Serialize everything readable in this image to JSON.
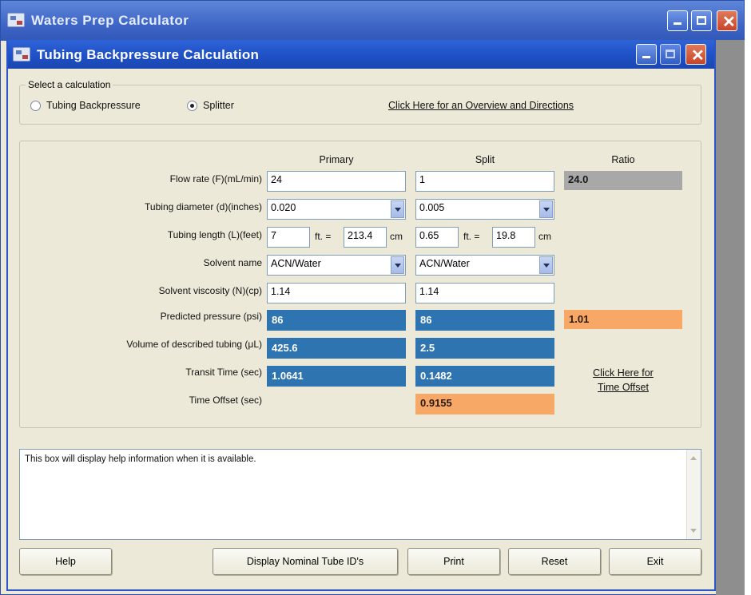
{
  "outer_window": {
    "title": "Waters Prep Calculator"
  },
  "window": {
    "title": "Tubing Backpressure Calculation"
  },
  "calc_select": {
    "legend": "Select a calculation",
    "options": [
      {
        "label": "Tubing Backpressure",
        "selected": false
      },
      {
        "label": "Splitter",
        "selected": true
      }
    ],
    "overview_link": "Click Here for an Overview and Directions"
  },
  "columns": {
    "primary": "Primary",
    "split": "Split",
    "ratio": "Ratio"
  },
  "rows": {
    "flow_rate": {
      "label": "Flow rate (F)(mL/min)",
      "primary": "24",
      "split": "1",
      "ratio": "24.0"
    },
    "tubing_diameter": {
      "label": "Tubing diameter (d)(inches)",
      "primary": "0.020",
      "split": "0.005"
    },
    "tubing_length": {
      "label": "Tubing length (L)(feet)",
      "primary_ft": "7",
      "primary_cm": "213.4",
      "split_ft": "0.65",
      "split_cm": "19.8",
      "eq": "ft. =",
      "unit_cm": "cm"
    },
    "solvent_name": {
      "label": "Solvent name",
      "primary": "ACN/Water",
      "split": "ACN/Water"
    },
    "solvent_viscosity": {
      "label": "Solvent viscosity (N)(cp)",
      "primary": "1.14",
      "split": "1.14"
    },
    "predicted_pressure": {
      "label": "Predicted pressure (psi)",
      "primary": "86",
      "split": "86",
      "ratio": "1.01"
    },
    "volume": {
      "label": "Volume of described tubing (μL)",
      "primary": "425.6",
      "split": "2.5"
    },
    "transit_time": {
      "label": "Transit Time (sec)",
      "primary": "1.0641",
      "split": "0.1482"
    },
    "time_offset": {
      "label": "Time Offset (sec)",
      "split": "0.9155"
    }
  },
  "time_offset_link": {
    "line1": "Click Here for",
    "line2": "Time Offset"
  },
  "help": {
    "text": "This box will display help information when it is available."
  },
  "buttons": {
    "help": "Help",
    "display_nominal": "Display Nominal Tube ID's",
    "print": "Print",
    "reset": "Reset",
    "exit": "Exit"
  },
  "colors": {
    "output_blue": "#2e74b0",
    "output_orange": "#f7a766",
    "ratio_gray": "#a8a8a8",
    "title_blue": "#1e4fc4"
  },
  "icons": [
    "app-icon",
    "minimize-icon",
    "maximize-icon",
    "close-icon",
    "dropdown-arrow-icon",
    "scroll-up-icon",
    "scroll-down-icon"
  ]
}
